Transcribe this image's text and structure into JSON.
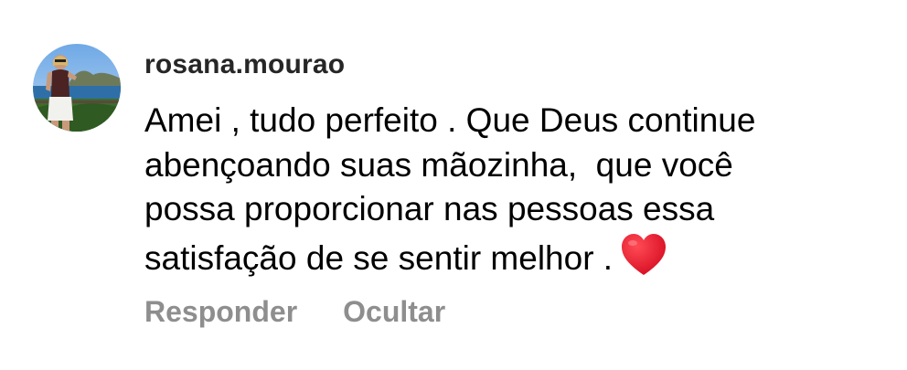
{
  "comment": {
    "username": "rosana.mourao",
    "text_lines": [
      "Amei , tudo perfeito . Que Deus continue",
      "abençoando suas mãozinha,  que você",
      "possa proporcionar nas pessoas essa",
      "satisfação de se sentir melhor ."
    ],
    "emoji_icon": "red-heart-icon",
    "avatar_icon": "profile-photo-avatar"
  },
  "actions": {
    "reply_label": "Responder",
    "hide_label": "Ocultar"
  },
  "colors": {
    "username": "#262626",
    "body_text": "#000000",
    "action_text": "#8e8e8e",
    "heart": "#e0102a",
    "background": "#ffffff"
  }
}
